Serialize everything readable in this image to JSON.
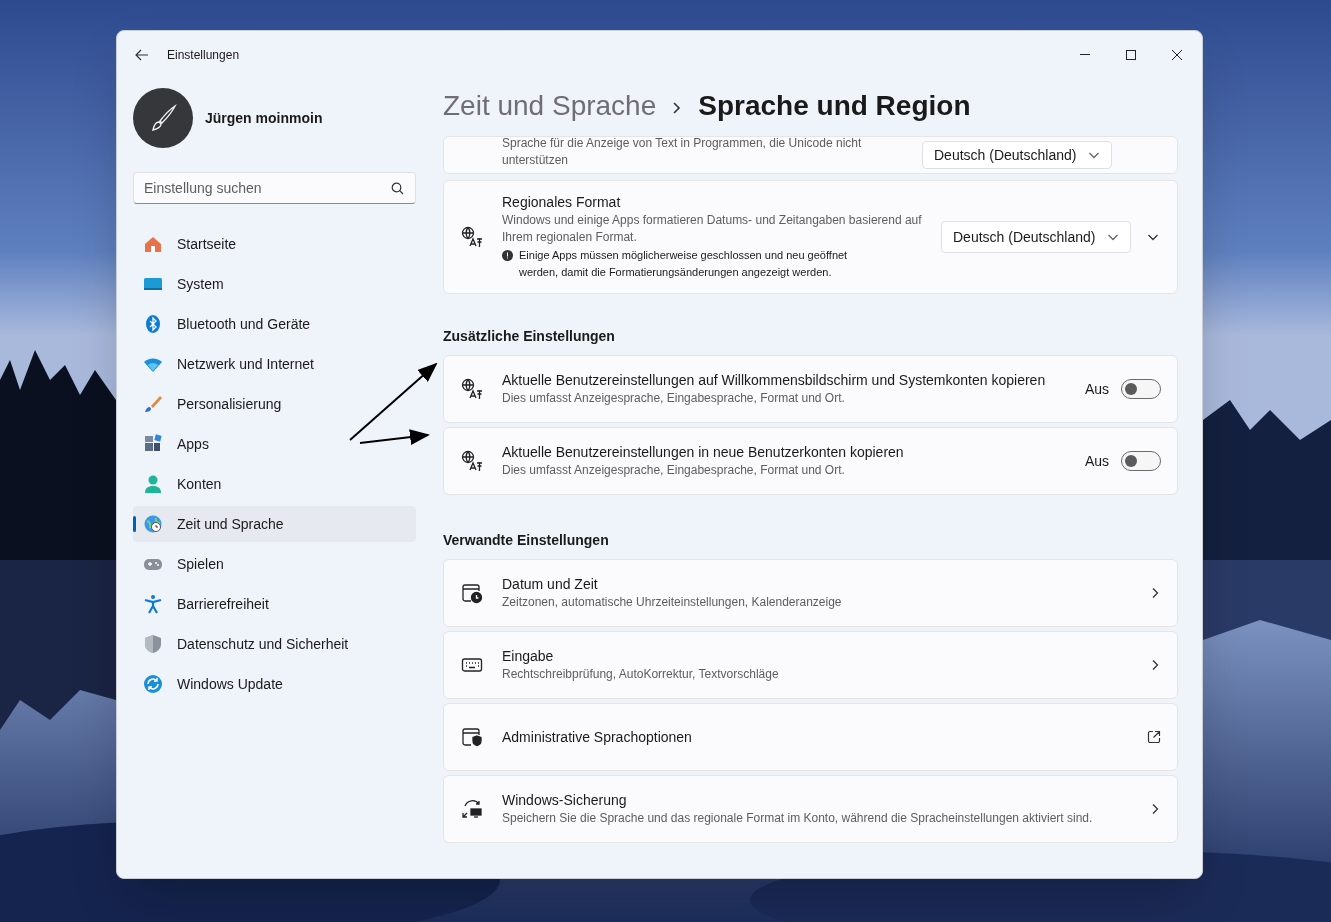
{
  "window": {
    "title": "Einstellungen"
  },
  "user": {
    "name": "Jürgen moinmoin"
  },
  "search": {
    "placeholder": "Einstellung suchen"
  },
  "nav": [
    {
      "label": "Startseite",
      "selected": false
    },
    {
      "label": "System",
      "selected": false
    },
    {
      "label": "Bluetooth und Geräte",
      "selected": false
    },
    {
      "label": "Netzwerk und Internet",
      "selected": false
    },
    {
      "label": "Personalisierung",
      "selected": false
    },
    {
      "label": "Apps",
      "selected": false
    },
    {
      "label": "Konten",
      "selected": false
    },
    {
      "label": "Zeit und Sprache",
      "selected": true
    },
    {
      "label": "Spielen",
      "selected": false
    },
    {
      "label": "Barrierefreiheit",
      "selected": false
    },
    {
      "label": "Datenschutz und Sicherheit",
      "selected": false
    },
    {
      "label": "Windows Update",
      "selected": false
    }
  ],
  "breadcrumb": {
    "parent": "Zeit und Sprache",
    "current": "Sprache und Region"
  },
  "top_card": {
    "description": "Sprache für die Anzeige von Text in Programmen, die Unicode nicht unterstützen",
    "dropdown": "Deutsch (Deutschland)"
  },
  "regional_format": {
    "title": "Regionales Format",
    "description": "Windows und einige Apps formatieren Datums- und Zeitangaben basierend auf Ihrem regionalen Format.",
    "note": "Einige Apps müssen möglicherweise geschlossen und neu geöffnet werden, damit die Formatierungsänderungen angezeigt werden.",
    "dropdown": "Deutsch (Deutschland)"
  },
  "sections": [
    {
      "heading": "Zusätzliche Einstellungen",
      "items": [
        {
          "kind": "toggle",
          "title": "Aktuelle Benutzereinstellungen auf Willkommensbildschirm und Systemkonten kopieren",
          "description": "Dies umfasst Anzeigesprache, Eingabesprache, Format und Ort.",
          "state_label": "Aus",
          "on": false
        },
        {
          "kind": "toggle",
          "title": "Aktuelle Benutzereinstellungen in neue Benutzerkonten kopieren",
          "description": "Dies umfasst Anzeigesprache, Eingabesprache, Format und Ort.",
          "state_label": "Aus",
          "on": false
        }
      ]
    },
    {
      "heading": "Verwandte Einstellungen",
      "items": [
        {
          "kind": "link",
          "title": "Datum und Zeit",
          "description": "Zeitzonen, automatische Uhrzeiteinstellungen, Kalenderanzeige"
        },
        {
          "kind": "link",
          "title": "Eingabe",
          "description": "Rechtschreibprüfung, AutoKorrektur, Textvorschläge"
        },
        {
          "kind": "external",
          "title": "Administrative Sprachoptionen"
        },
        {
          "kind": "link",
          "title": "Windows-Sicherung",
          "description": "Speichern Sie die Sprache und das regionale Format im Konto, während die Spracheinstellungen aktiviert sind."
        }
      ]
    }
  ]
}
